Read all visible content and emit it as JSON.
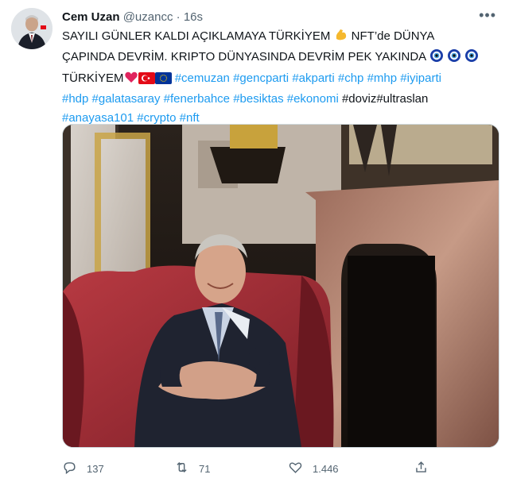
{
  "tweet": {
    "display_name": "Cem Uzan",
    "handle": "@uzancc",
    "separator": "·",
    "time": "16s",
    "more_icon": "more-dots-icon",
    "text": {
      "line1": "SAYILI GÜNLER KALDI AÇIKLAMAYA TÜRKİYEM",
      "line1b": " NFT’de DÜNYA",
      "line2": "ÇAPINDA DEVRİM. KRIPTO DÜNYASINDA DEVRİM PEK YAKINDA",
      "line3_start": "TÜRKİYEM",
      "tags_line3": [
        "#cemuzan",
        "#gencparti",
        "#akparti",
        "#chp",
        "#mhp",
        "#iyiparti"
      ],
      "tags_line4": [
        "#hdp",
        "#galatasaray",
        "#fenerbahce",
        "#besiktas",
        "#ekonomi"
      ],
      "plain_line4": "#doviz#ultraslan",
      "tags_line5": [
        "#anayasa101",
        "#crypto",
        "#nft"
      ]
    },
    "emojis": [
      "flexed-biceps",
      "nazar-amulet",
      "nazar-amulet",
      "nazar-amulet",
      "red-heart",
      "turkey-flag",
      "eu-flag"
    ],
    "actions": {
      "reply": {
        "icon": "reply-icon",
        "count": "137"
      },
      "retweet": {
        "icon": "retweet-icon",
        "count": "71"
      },
      "like": {
        "icon": "heart-icon",
        "count": "1.446"
      },
      "share": {
        "icon": "share-icon"
      }
    },
    "colors": {
      "link": "#1d9bf0",
      "meta": "#536471",
      "text": "#0f1419",
      "border": "#cfd9de"
    }
  }
}
